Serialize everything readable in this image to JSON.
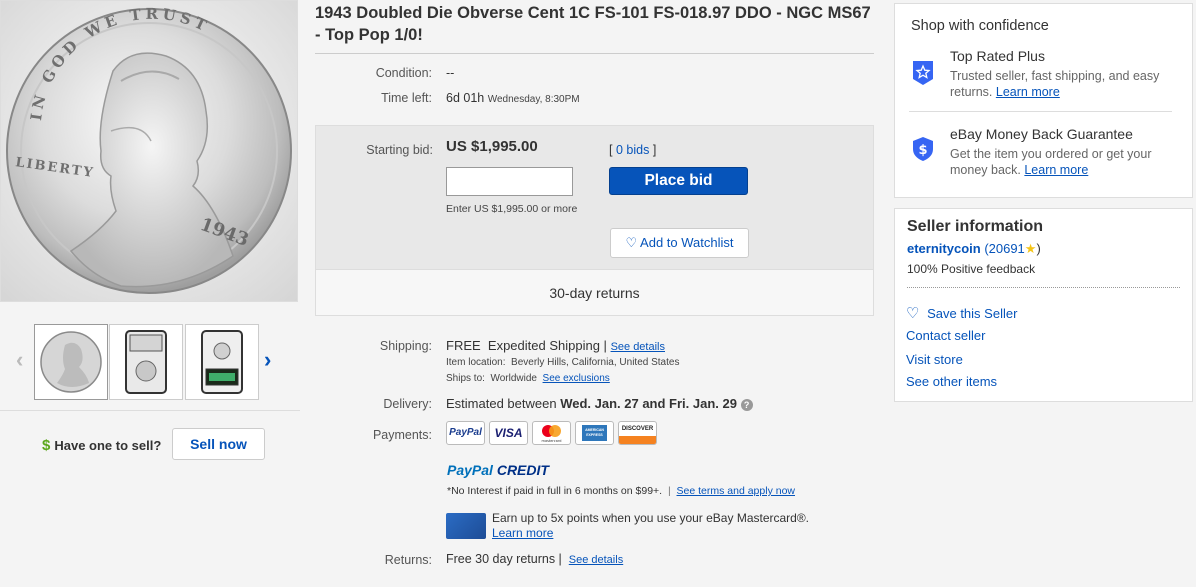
{
  "listing": {
    "title": "1943 Doubled Die Obverse Cent 1C FS-101 FS-018.97 DDO - NGC MS67 - Top Pop 1/0!",
    "condition_label": "Condition:",
    "condition_value": "--",
    "time_left_label": "Time left:",
    "time_left_value": "6d 01h",
    "time_left_detail": "Wednesday, 8:30PM"
  },
  "bid": {
    "starting_label": "Starting bid:",
    "price": "US $1,995.00",
    "bids_open": "[",
    "bids_link": "0 bids",
    "bids_close": "]",
    "input_value": "",
    "hint": "Enter US $1,995.00 or more",
    "place_bid_label": "Place bid",
    "watchlist_label": "Add to Watchlist",
    "returns_label": "30-day returns"
  },
  "shipping": {
    "label": "Shipping:",
    "free": "FREE",
    "method": "Expedited Shipping |",
    "see_details": "See details",
    "location_label": "Item location:",
    "location_value": "Beverly Hills, California, United States",
    "ships_to_label": "Ships to:",
    "ships_to_value": "Worldwide",
    "see_exclusions": "See exclusions"
  },
  "delivery": {
    "label": "Delivery:",
    "prefix": "Estimated between",
    "dates": "Wed. Jan. 27 and Fri. Jan. 29"
  },
  "payments": {
    "label": "Payments:",
    "cards": [
      "PayPal",
      "VISA",
      "mastercard",
      "AMERICAN EXPRESS",
      "DISCOVER"
    ],
    "paypal_credit_1": "PayPal",
    "paypal_credit_2": "CREDIT",
    "credit_note": "*No Interest if paid in full in 6 months on $99+.",
    "credit_sep": "|",
    "credit_link": "See terms and apply now",
    "mastercard_promo": "Earn up to 5x points when you use your eBay Mastercard®.",
    "learn_more": "Learn more"
  },
  "returns": {
    "label": "Returns:",
    "value": "Free 30 day returns |",
    "see_details": "See details"
  },
  "sell": {
    "question": "Have one to sell?",
    "button": "Sell now"
  },
  "confidence": {
    "heading": "Shop with confidence",
    "trp_title": "Top Rated Plus",
    "trp_desc": "Trusted seller, fast shipping, and easy returns.",
    "trp_link": "Learn more",
    "mbg_title": "eBay Money Back Guarantee",
    "mbg_desc": "Get the item you ordered or get your money back.",
    "mbg_link": "Learn more"
  },
  "seller": {
    "heading": "Seller information",
    "name": "eternitycoin",
    "score_open": "(20691",
    "score_close": ")",
    "feedback": "100% Positive feedback",
    "save": "Save this Seller",
    "contact": "Contact seller",
    "visit": "Visit store",
    "other": "See other items"
  },
  "coin": {
    "motto": "IN GOD WE TRUST",
    "liberty": "LIBERTY",
    "year": "1943"
  },
  "colors": {
    "link": "#0654ba",
    "button": "#0654ba",
    "dollar_green": "#5ba71b"
  }
}
